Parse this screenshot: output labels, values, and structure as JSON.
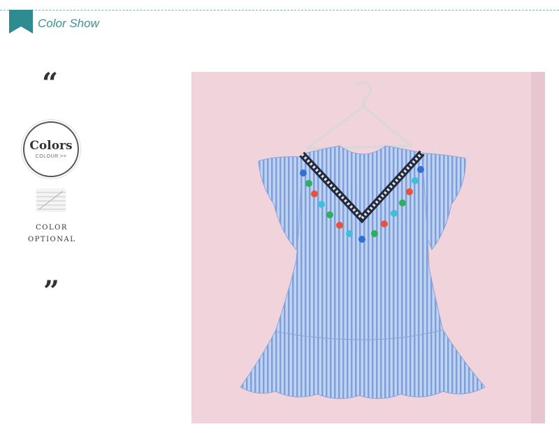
{
  "header": {
    "title": "Color Show",
    "icon": "bookmark-ribbon-icon",
    "accent": "#2e8b8f"
  },
  "sidebar": {
    "quote_open": "“",
    "quote_close": "”",
    "badge": {
      "title": "Colors",
      "subtitle": "COLOUR >>"
    },
    "optional_line1": "COLOR",
    "optional_line2": "OPTIONAL"
  },
  "product": {
    "kind": "photo",
    "background": "#f0d3db",
    "dress_color": "#9fb8e6"
  }
}
